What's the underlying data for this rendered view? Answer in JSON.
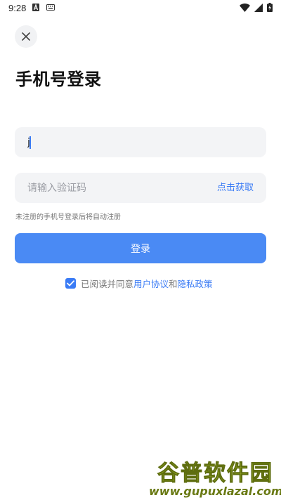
{
  "status_bar": {
    "time": "9:28",
    "icons": [
      "a-notification-icon",
      "keyboard-icon",
      "wifi-icon",
      "signal-icon",
      "battery-charging-icon"
    ]
  },
  "header": {
    "title": "手机号登录"
  },
  "form": {
    "phone_value": "j",
    "code_placeholder": "请输入验证码",
    "get_code_label": "点击获取",
    "hint": "未注册的手机号登录后将自动注册",
    "login_label": "登录"
  },
  "agreement": {
    "checked": true,
    "prefix": "已阅读并同意",
    "user_agreement": "用户协议",
    "conjunction": "和",
    "privacy_policy": "隐私政策"
  },
  "watermark": {
    "cn": "谷普软件园",
    "en": "www.gupuxlazal.com"
  },
  "colors": {
    "accent": "#3a7bf5",
    "button": "#4a8af4",
    "field_bg": "#f3f4f6"
  }
}
